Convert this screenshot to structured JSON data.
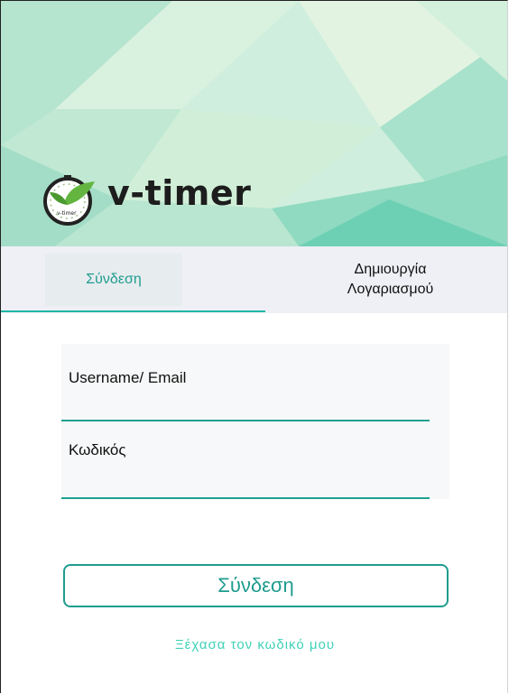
{
  "brand": {
    "name": "v-timer",
    "badge_text": "v-timer"
  },
  "tabs": {
    "login": "Σύνδεση",
    "signup_line1": "Δημιουργία",
    "signup_line2": "Λογαριασμού",
    "active": "login"
  },
  "form": {
    "username_label": "Username/ Email",
    "password_label": "Κωδικός",
    "submit_label": "Σύνδεση",
    "forgot_link": "Ξέχασα τον κωδικό μου"
  },
  "colors": {
    "accent": "#1f9c8e",
    "link": "#3fd2b8",
    "tab_bar": "#eef0f5",
    "hero_base": "#cdeedd"
  }
}
